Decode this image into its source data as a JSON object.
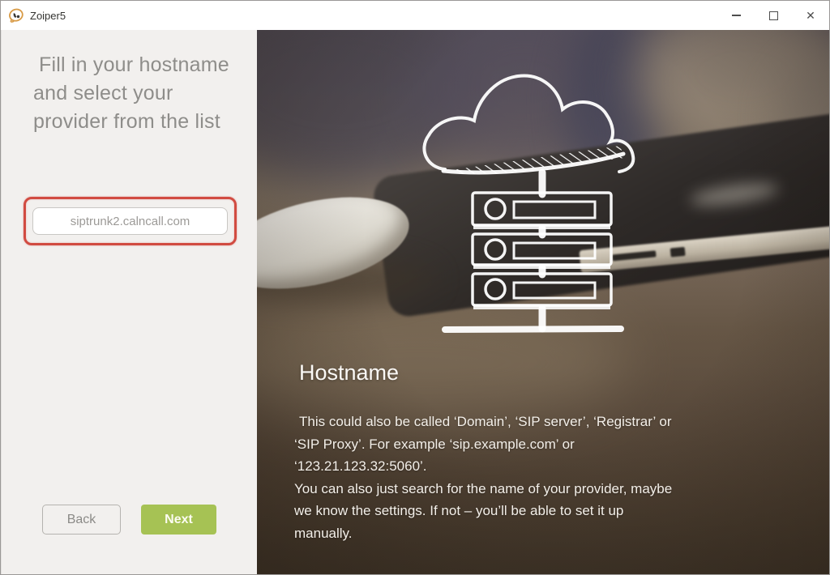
{
  "window": {
    "title": "Zoiper5",
    "controls": {
      "minimize_icon": "minimize-icon",
      "maximize_icon": "maximize-icon",
      "close_icon": "close-icon",
      "close_glyph": "✕"
    }
  },
  "wizard": {
    "heading_lines": [
      "Fill in your hostname",
      "and select your",
      "provider from the list"
    ],
    "hostname_input": {
      "value": "siptrunk2.calncall.com",
      "placeholder": ""
    },
    "back_label": "Back",
    "next_label": "Next",
    "accent_green": "#a6c254",
    "highlight_red": "#d14b41",
    "panel_bg": "#f2f0ee"
  },
  "info_panel": {
    "title": "Hostname",
    "description_lines": [
      "This could also be called ‘Domain’, ‘SIP server’, ‘Registrar’ or",
      "‘SIP Proxy’. For example ‘sip.example.com’ or",
      "‘123.21.123.32:5060’.",
      "You can also just search for the name of your provider, maybe",
      "we know the settings. If not – you’ll be able to set it up",
      "manually."
    ],
    "illustration": "cloud-connected-to-server-stack-sketch"
  }
}
